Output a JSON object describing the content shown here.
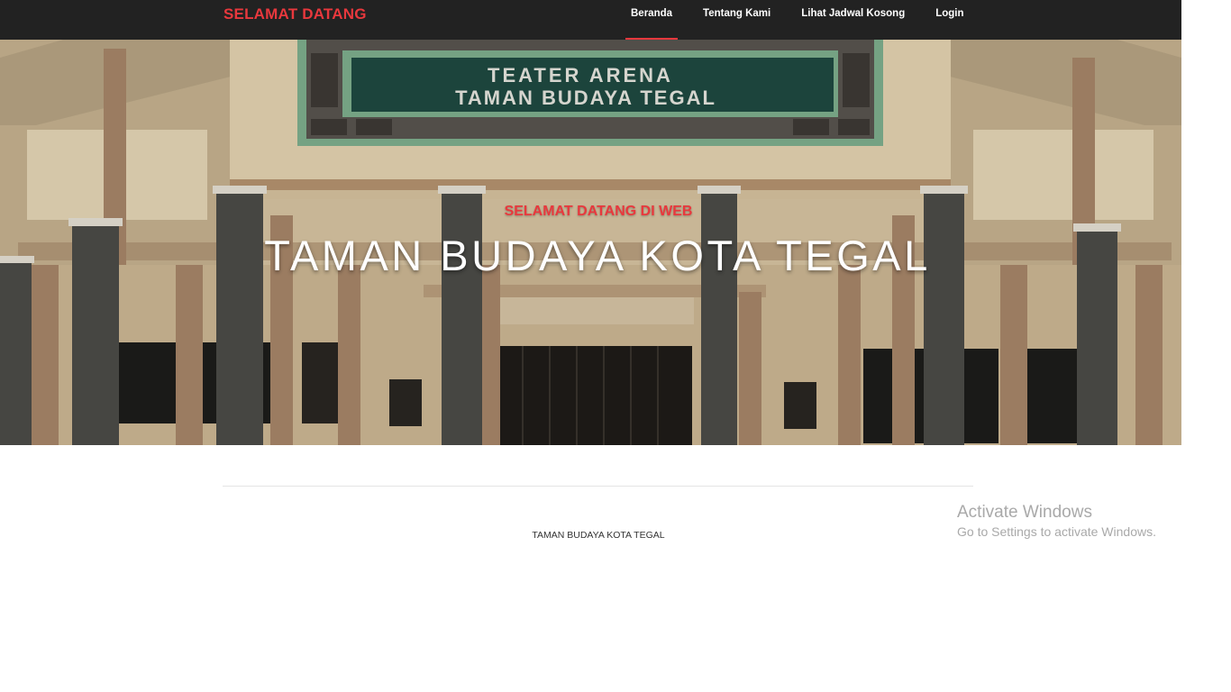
{
  "navbar": {
    "brand": "SELAMAT DATANG",
    "links": [
      {
        "label": "Beranda",
        "active": true
      },
      {
        "label": "Tentang Kami",
        "active": false
      },
      {
        "label": "Lihat Jadwal Kosong",
        "active": false
      },
      {
        "label": "Login",
        "active": false
      }
    ]
  },
  "hero": {
    "subtitle": "SELAMAT DATANG DI WEB",
    "title": "TAMAN BUDAYA KOTA TEGAL",
    "sign_line1": "TEATER ARENA",
    "sign_line2": "TAMAN BUDAYA TEGAL"
  },
  "footer": {
    "text": "TAMAN BUDAYA KOTA TEGAL"
  },
  "watermark": {
    "title": "Activate Windows",
    "subtitle": "Go to Settings to activate Windows."
  },
  "colors": {
    "accent": "#e8383d",
    "navbar_bg": "#222222",
    "sign_bg": "#1f4a42",
    "sign_frame": "#7fb08f"
  }
}
